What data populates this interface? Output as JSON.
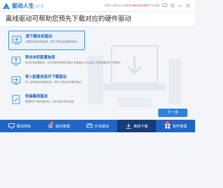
{
  "app": {
    "name": "驱动人生",
    "version": "v7.0",
    "ad_text_prefix": "您有1个驱动可以升级到",
    "ad_highlight": "1.801,138.332",
    "ad_text_suffix": "用户的选择"
  },
  "header": {
    "title": "离线驱动可帮助您预先下载对应的硬件驱动"
  },
  "options": [
    {
      "title": "按下载本机驱动",
      "desc": "根据本机检测的结果，预先下载对应的硬件驱动"
    },
    {
      "title": "导出本机配置信息",
      "desc": "导出本机配置信息，可在其他有网络的电脑上安装驱动人生后导入本机配置信息下载驱动"
    },
    {
      "title": "导入配置信息并下载驱动",
      "desc": "导入其他电脑的配置信息，预先下载对应的硬件驱动"
    },
    {
      "title": "安装离线驱动",
      "desc": "根据预先下载的驱动包，为本机进行驱动安装"
    }
  ],
  "next_button": "下一步",
  "tabs": [
    {
      "label": "驱动体检",
      "icon": "monitor-icon"
    },
    {
      "label": "驱动管理",
      "icon": "gear-icon",
      "badge": "1"
    },
    {
      "label": "外设驱动",
      "icon": "printer-icon"
    },
    {
      "label": "离线下载",
      "icon": "download-icon"
    },
    {
      "label": "软件管理",
      "icon": "apps-icon",
      "badge": "1"
    }
  ],
  "colors": {
    "accent": "#2f82dc",
    "tabbar": "#1f66c6",
    "tab_active": "#173c7a",
    "badge": "#ff4a3a"
  }
}
